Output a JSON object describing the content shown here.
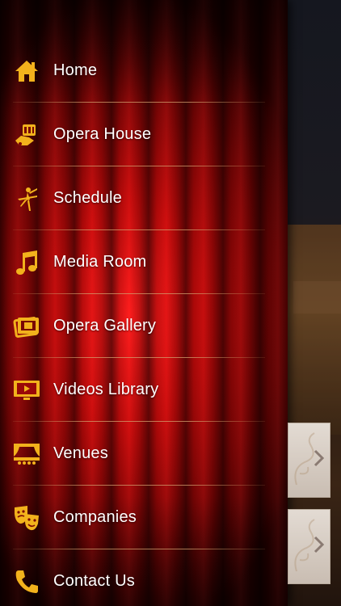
{
  "menu": {
    "items": [
      {
        "label": "Home",
        "icon": "home-icon"
      },
      {
        "label": "Opera House",
        "icon": "opera-house-icon"
      },
      {
        "label": "Schedule",
        "icon": "ballerina-icon"
      },
      {
        "label": "Media Room",
        "icon": "music-note-icon"
      },
      {
        "label": "Opera Gallery",
        "icon": "photo-gallery-icon"
      },
      {
        "label": "Videos Library",
        "icon": "video-screen-icon"
      },
      {
        "label": "Venues",
        "icon": "stage-icon"
      },
      {
        "label": "Companies",
        "icon": "theater-masks-icon"
      },
      {
        "label": "Contact Us",
        "icon": "phone-icon"
      }
    ]
  },
  "colors": {
    "icon_gold": "#f2b21c",
    "curtain_red": "#c90a0a",
    "text": "#ffffff",
    "divider": "#d2a06e"
  },
  "side_tiles": [
    {
      "icon": "chevron-right-icon"
    },
    {
      "icon": "chevron-right-icon"
    }
  ]
}
